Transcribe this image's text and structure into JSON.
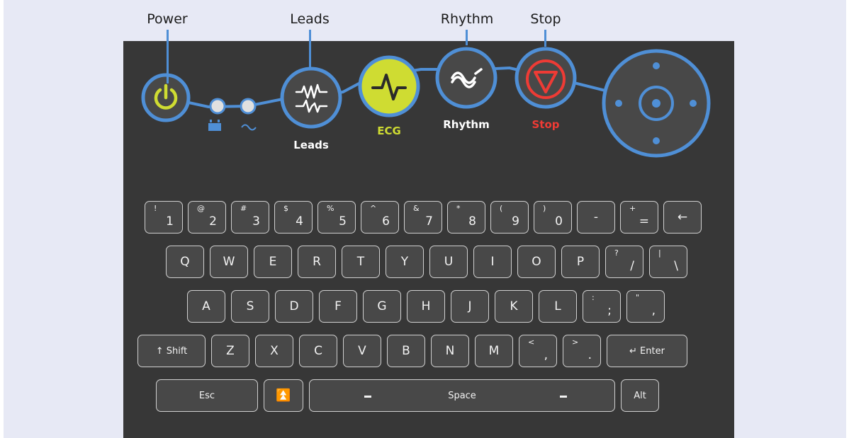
{
  "callouts": {
    "power": "Power",
    "leads": "Leads",
    "rhythm": "Rhythm",
    "stop": "Stop"
  },
  "panel_buttons": {
    "leads": "Leads",
    "ecg": "ECG",
    "rhythm": "Rhythm",
    "stop": "Stop"
  },
  "icons": [
    "power-icon",
    "battery-icon",
    "ac-power-icon",
    "leads-icon",
    "ecg-icon",
    "rhythm-icon",
    "stop-icon",
    "navigation-pad"
  ],
  "colors": {
    "accent_blue": "#4f8fd6",
    "ecg_green": "#cfdc32",
    "stop_red": "#ef3b35",
    "panel": "#373737"
  },
  "keyboard": {
    "row1": [
      {
        "shift": "!",
        "base": "1"
      },
      {
        "shift": "@",
        "base": "2"
      },
      {
        "shift": "#",
        "base": "3"
      },
      {
        "shift": "$",
        "base": "4"
      },
      {
        "shift": "%",
        "base": "5"
      },
      {
        "shift": "^",
        "base": "6"
      },
      {
        "shift": "&",
        "base": "7"
      },
      {
        "shift": "*",
        "base": "8"
      },
      {
        "shift": "(",
        "base": "9"
      },
      {
        "shift": ")",
        "base": "0"
      },
      {
        "shift": "",
        "base": "-"
      },
      {
        "shift": "+",
        "base": "="
      },
      {
        "shift": "",
        "base": "←"
      }
    ],
    "row2": [
      {
        "shift": "",
        "base": "Q"
      },
      {
        "shift": "",
        "base": "W"
      },
      {
        "shift": "",
        "base": "E"
      },
      {
        "shift": "",
        "base": "R"
      },
      {
        "shift": "",
        "base": "T"
      },
      {
        "shift": "",
        "base": "Y"
      },
      {
        "shift": "",
        "base": "U"
      },
      {
        "shift": "",
        "base": "I"
      },
      {
        "shift": "",
        "base": "O"
      },
      {
        "shift": "",
        "base": "P"
      },
      {
        "shift": "?",
        "base": "/"
      },
      {
        "shift": "|",
        "base": "\\"
      }
    ],
    "row3": [
      {
        "shift": "",
        "base": "A"
      },
      {
        "shift": "",
        "base": "S"
      },
      {
        "shift": "",
        "base": "D"
      },
      {
        "shift": "",
        "base": "F"
      },
      {
        "shift": "",
        "base": "G"
      },
      {
        "shift": "",
        "base": "H"
      },
      {
        "shift": "",
        "base": "J"
      },
      {
        "shift": "",
        "base": "K"
      },
      {
        "shift": "",
        "base": "L"
      },
      {
        "shift": ":",
        "base": ";"
      },
      {
        "shift": "\"",
        "base": ","
      }
    ],
    "row4": [
      {
        "shift": "",
        "base": "↑ Shift"
      },
      {
        "shift": "",
        "base": "Z"
      },
      {
        "shift": "",
        "base": "X"
      },
      {
        "shift": "",
        "base": "C"
      },
      {
        "shift": "",
        "base": "V"
      },
      {
        "shift": "",
        "base": "B"
      },
      {
        "shift": "",
        "base": "N"
      },
      {
        "shift": "",
        "base": "M"
      },
      {
        "shift": "<",
        "base": ","
      },
      {
        "shift": ">",
        "base": "."
      },
      {
        "shift": "",
        "base": "↵ Enter"
      }
    ],
    "row5": [
      {
        "shift": "",
        "base": "Esc"
      },
      {
        "shift": "",
        "base": "⏫"
      },
      {
        "shift": "",
        "base": "Space"
      },
      {
        "shift": "",
        "base": "Alt"
      }
    ]
  }
}
